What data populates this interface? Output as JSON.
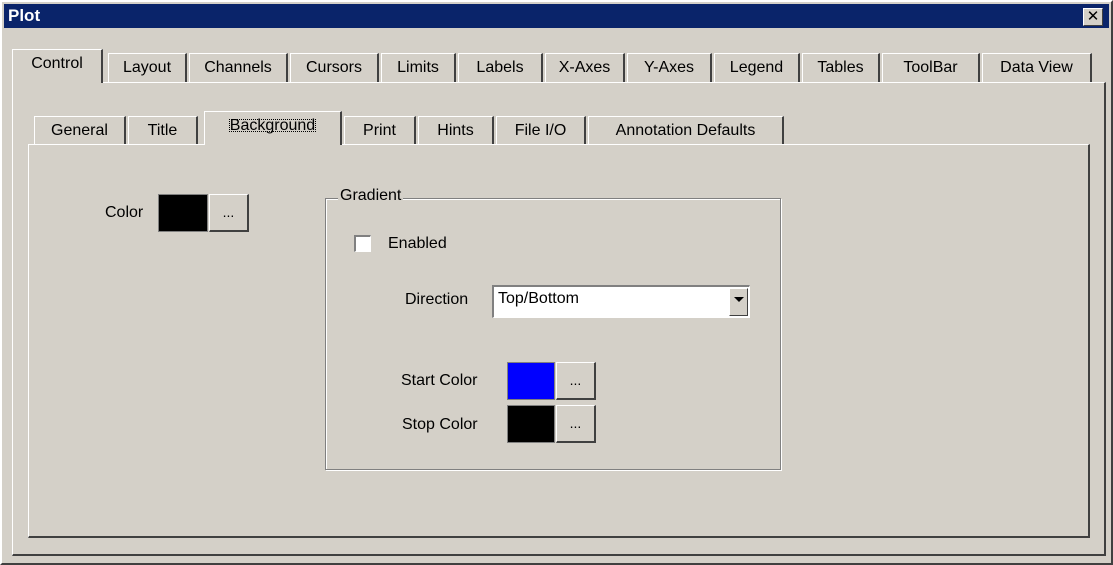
{
  "window": {
    "title": "Plot",
    "close_glyph": "✕"
  },
  "main_tabs": [
    "Control",
    "Layout",
    "Channels",
    "Cursors",
    "Limits",
    "Labels",
    "X-Axes",
    "Y-Axes",
    "Legend",
    "Tables",
    "ToolBar",
    "Data View"
  ],
  "active_main_tab": "Control",
  "sub_tabs": [
    "General",
    "Title",
    "Background",
    "Print",
    "Hints",
    "File I/O",
    "Annotation Defaults"
  ],
  "active_sub_tab": "Background",
  "background": {
    "color_label": "Color",
    "color_value": "#000000",
    "ellipsis": "..."
  },
  "gradient": {
    "group_title": "Gradient",
    "enabled_label": "Enabled",
    "enabled": false,
    "direction_label": "Direction",
    "direction_value": "Top/Bottom",
    "start_color_label": "Start Color",
    "start_color_value": "#0000ff",
    "stop_color_label": "Stop Color",
    "stop_color_value": "#000000",
    "ellipsis": "..."
  },
  "icons": {
    "dropdown": "chevron-down-icon",
    "close": "close-icon"
  }
}
